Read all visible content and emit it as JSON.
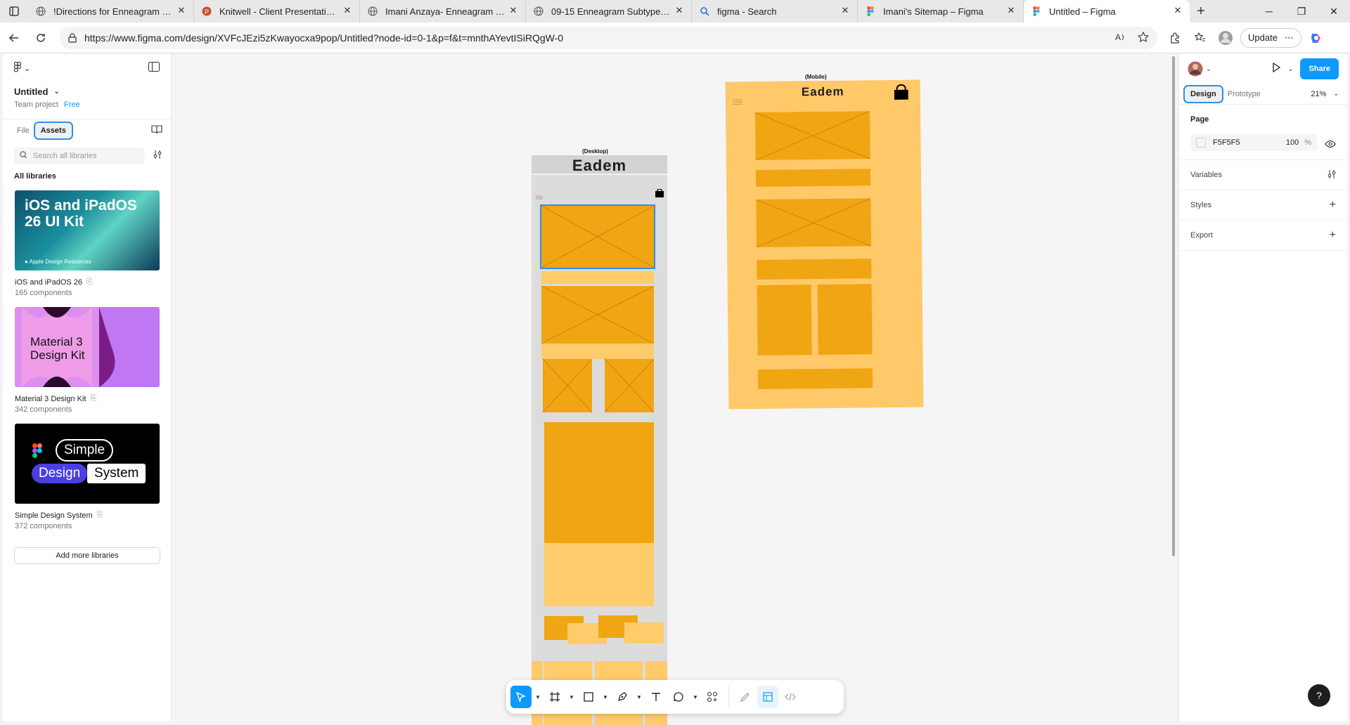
{
  "browser": {
    "tabs": [
      {
        "label": "!Directions for Enneagram Typing",
        "icon": "globe-icon"
      },
      {
        "label": "Knitwell - Client Presentation.pptx",
        "icon": "powerpoint-icon"
      },
      {
        "label": "Imani Anzaya- Enneagram Typing",
        "icon": "globe-icon"
      },
      {
        "label": "09-15 Enneagram Subtypes.docx",
        "icon": "globe-icon"
      },
      {
        "label": "figma - Search",
        "icon": "search-icon"
      },
      {
        "label": "Imani's Sitemap – Figma",
        "icon": "figma-icon"
      },
      {
        "label": "Untitled – Figma",
        "icon": "figma-icon"
      }
    ],
    "url": "https://www.figma.com/design/XVFcJEzi5zKwayocxa9pop/Untitled?node-id=0-1&p=f&t=mnthAYevtISiRQgW-0",
    "update_label": "Update"
  },
  "left_panel": {
    "file_name": "Untitled",
    "team": "Team project",
    "plan": "Free",
    "tabs": [
      "File",
      "Assets"
    ],
    "search_placeholder": "Search all libraries",
    "section_title": "All libraries",
    "libraries": [
      {
        "thumb_title": "iOS and iPadOS 26 UI Kit",
        "thumb_footer": "Apple Design Resources",
        "name": "iOS and iPadOS 26",
        "count": "165 components"
      },
      {
        "thumb_title": "Material 3 Design Kit",
        "name": "Material 3 Design Kit",
        "count": "342 components"
      },
      {
        "thumb_words": [
          "Simple",
          "Design",
          "System"
        ],
        "name": "Simple Design System",
        "count": "372 components"
      }
    ],
    "add_libraries": "Add more libraries"
  },
  "canvas": {
    "desktop_label": "(Desktop)",
    "desktop_title": "Eadem",
    "mobile_label": "(Mobile)",
    "mobile_title": "Eadem",
    "accent": "#f0a513",
    "accent_light": "#ffcb6b"
  },
  "right_panel": {
    "share": "Share",
    "tabs": [
      "Design",
      "Prototype"
    ],
    "zoom": "21%",
    "page_heading": "Page",
    "page_color": "F5F5F5",
    "page_opacity": "100",
    "percent": "%",
    "sections": [
      "Variables",
      "Styles",
      "Export"
    ]
  },
  "help": "?"
}
